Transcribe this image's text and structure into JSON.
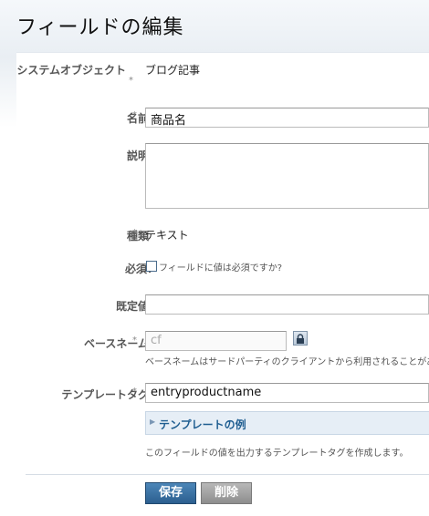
{
  "header": {
    "title": "フィールドの編集"
  },
  "form": {
    "system_object": {
      "label": "システムオブジェクト",
      "required": "*",
      "value": "ブログ記事"
    },
    "name": {
      "label": "名前",
      "required": "*",
      "value": "商品名"
    },
    "description": {
      "label": "説明",
      "value": ""
    },
    "type": {
      "label": "種類",
      "required": "*",
      "value": "テキスト"
    },
    "required_field": {
      "label": "必須?",
      "checkbox_label": "フィールドに値は必須ですか?",
      "checked": false
    },
    "default_value": {
      "label": "既定値",
      "value": ""
    },
    "basename": {
      "label": "ベースネーム",
      "required": "*",
      "value": "cf",
      "hint": "ベースネームはサードパーティのクライアントから利用されることがあ"
    },
    "template_tag": {
      "label": "テンプレートタグ",
      "required": "*",
      "value": "entryproductname",
      "example_toggle": "テンプレートの例",
      "hint": "このフィールドの値を出力するテンプレートタグを作成します。"
    }
  },
  "actions": {
    "save": "保存",
    "delete": "削除"
  },
  "colors": {
    "accent": "#2c5f8f",
    "link": "#1f5e91",
    "expander_bg": "#e6eef6",
    "delete_bg": "#999999"
  }
}
